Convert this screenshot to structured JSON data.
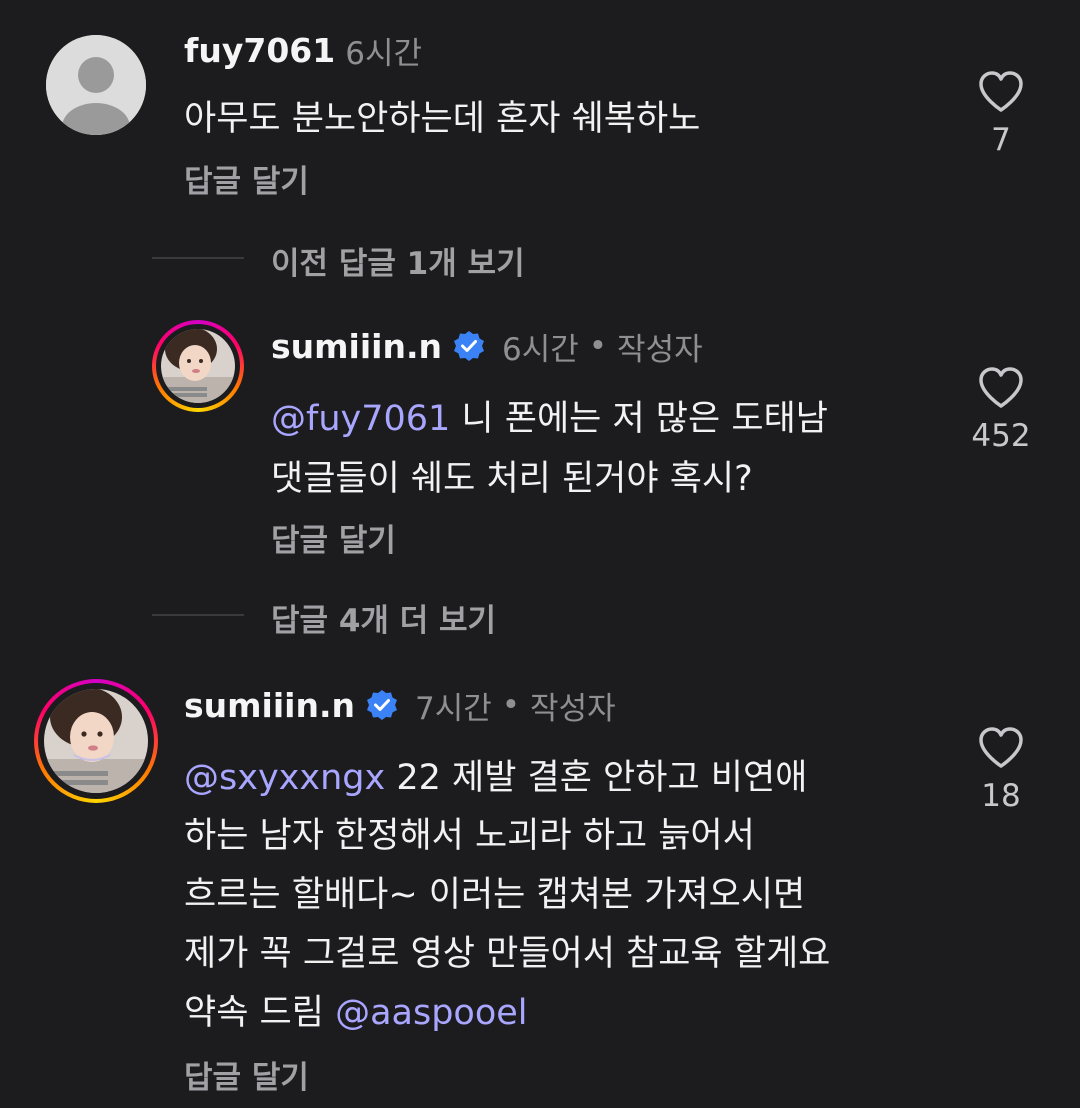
{
  "comments": [
    {
      "username": "fuy7061",
      "time": "6시간",
      "text_lines": [
        "아무도 분노안하는데 혼자 쉐복하노"
      ],
      "reply_label": "답글 달기",
      "likes": "7"
    }
  ],
  "thread1": {
    "view_previous": "이전 답글 1개 보기",
    "reply": {
      "username": "sumiiin.n",
      "time": "6시간",
      "separator": "•",
      "author_tag": "작성자",
      "mention": "@fuy7061",
      "line1_rest": " 니 폰에는 저 많은 도태남",
      "line2": "댓글들이 쉐도 처리 된거야 혹시?",
      "reply_label": "답글 달기",
      "likes": "452"
    },
    "view_more": "답글 4개 더 보기"
  },
  "comment2": {
    "username": "sumiiin.n",
    "time": "7시간",
    "separator": "•",
    "author_tag": "작성자",
    "mention1": "@sxyxxngx",
    "line1_rest": " 22 제발 결혼 안하고 비연애",
    "line2": "하는 남자 한정해서 노괴라 하고 늙어서",
    "line3": "흐르는 할배다~ 이러는 캡쳐본 가져오시면",
    "line4": "제가 꼭 그걸로 영상 만들어서 참교육 할게요",
    "line5_pre": "약속 드림 ",
    "mention2": "@aaspooel",
    "reply_label": "답글 달기",
    "likes": "18"
  },
  "colors": {
    "background": "#1c1c1e",
    "mention": "#a9a6ff",
    "verified": "#3b82f6"
  }
}
